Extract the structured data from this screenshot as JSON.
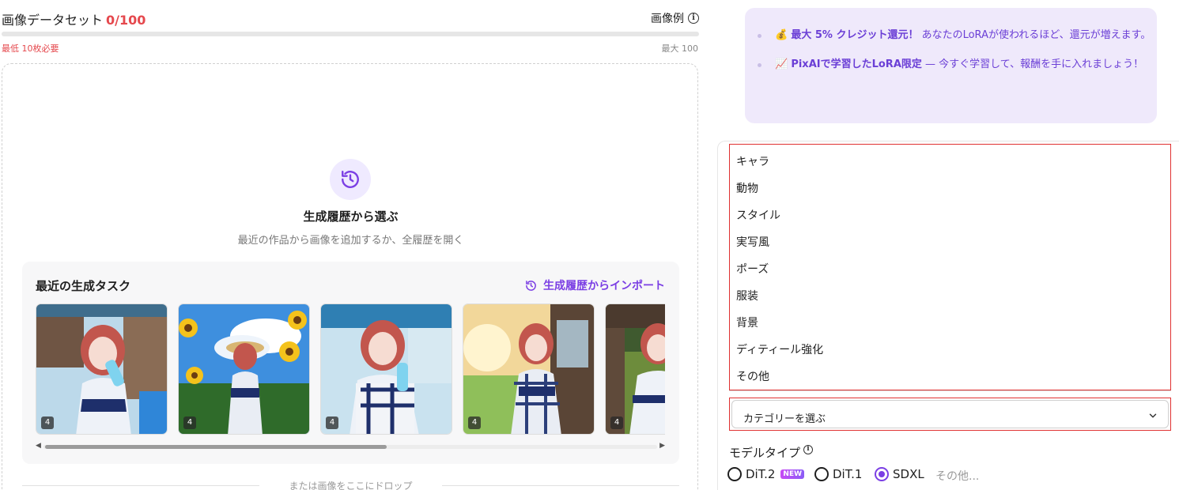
{
  "dataset": {
    "title": "画像データセット",
    "count": "0/100",
    "example_label": "画像例",
    "min_label": "最低 10枚必要",
    "max_label": "最大 100"
  },
  "dropzone": {
    "title": "生成履歴から選ぶ",
    "subtitle": "最近の作品から画像を追加するか、全履歴を開く",
    "recent_title": "最近の生成タスク",
    "import_label": "生成履歴からインポート",
    "thumbnails": [
      {
        "badge": "4"
      },
      {
        "badge": "4"
      },
      {
        "badge": "4"
      },
      {
        "badge": "4"
      },
      {
        "badge": "4"
      }
    ],
    "drop_hint": "または画像をここにドロップ"
  },
  "promo": {
    "item1_emoji": "💰",
    "item1_bold": "最大 5% クレジット還元！",
    "item1_text": "あなたのLoRAが使われるほど、還元が増えます。",
    "item2_emoji": "📈",
    "item2_bold": "PixAIで学習したLoRA限定",
    "item2_text": "— 今すぐ学習して、報酬を手に入れましょう！"
  },
  "category_menu": {
    "items": [
      "キャラ",
      "動物",
      "スタイル",
      "実写風",
      "ポーズ",
      "服装",
      "背景",
      "ディティール強化",
      "その他"
    ]
  },
  "category_select": {
    "placeholder": "カテゴリーを選ぶ"
  },
  "model_type": {
    "label": "モデルタイプ",
    "options": [
      {
        "label": "DiT.2",
        "badge": "NEW",
        "selected": false
      },
      {
        "label": "DiT.1",
        "selected": false
      },
      {
        "label": "SDXL",
        "selected": true
      }
    ],
    "more": "その他..."
  },
  "colors": {
    "accent": "#7b3fe4",
    "danger": "#e5484d",
    "highlight_border": "#e03131",
    "promo_bg": "#efe9fb"
  }
}
